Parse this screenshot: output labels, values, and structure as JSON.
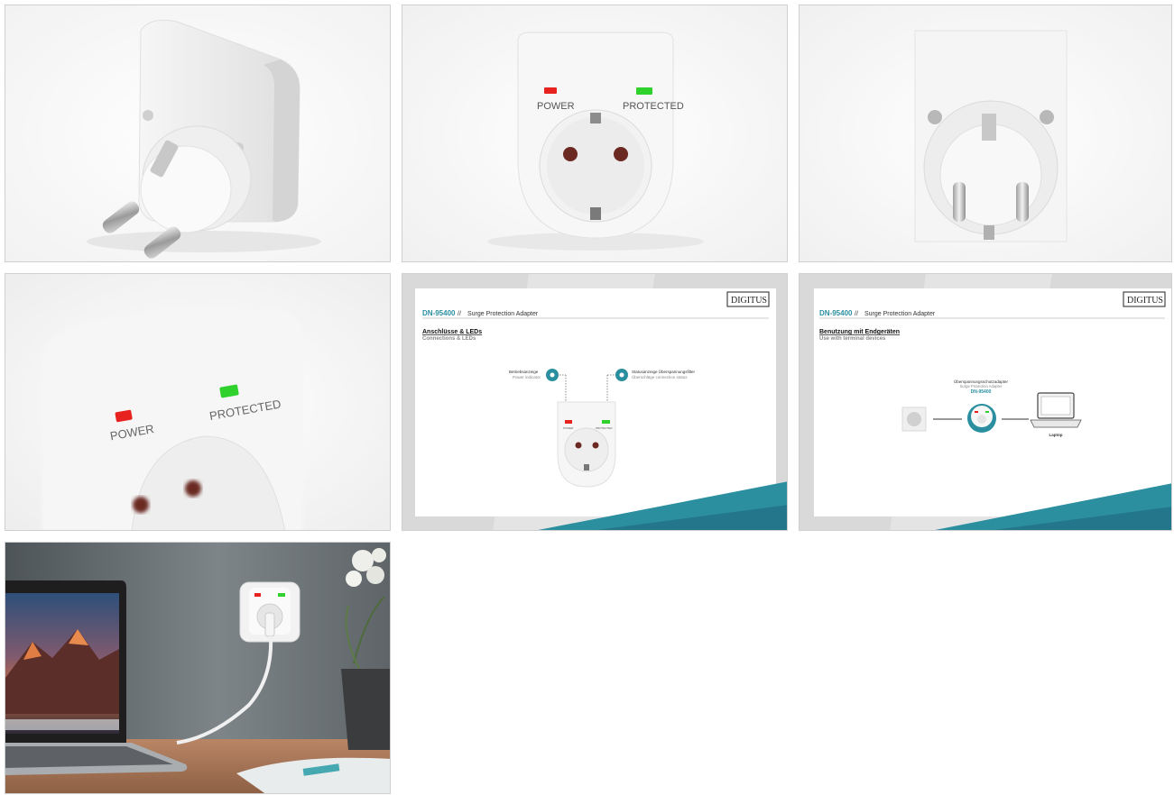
{
  "gallery": {
    "tiles": [
      {
        "subject": "adapter-side-view"
      },
      {
        "subject": "adapter-front-view"
      },
      {
        "subject": "adapter-back-view"
      },
      {
        "subject": "adapter-led-closeup"
      },
      {
        "subject": "slide-connections-leds"
      },
      {
        "subject": "slide-terminal-devices"
      },
      {
        "subject": "lifestyle-laptop-scene"
      }
    ]
  },
  "product": {
    "led_power": "POWER",
    "led_protected": "PROTECTED",
    "led_power_color": "#e8221f",
    "led_protected_color": "#2fd12c"
  },
  "slide1": {
    "model": "DN-95400",
    "separator": "//",
    "product_name": "Surge Protection Adapter",
    "brand": "DIGITUS",
    "heading_de": "Anschlüsse & LEDs",
    "heading_en": "Connections & LEDs",
    "callout_left_de": "Betriebsanzeige",
    "callout_left_en": "Power indicator",
    "callout_right_de": "Statusanzeige Überspannungsfilter",
    "callout_right_en": "Überschläge connection status",
    "mini_power": "POWER",
    "mini_protected": "PROTECTED"
  },
  "slide2": {
    "model": "DN-95400",
    "separator": "//",
    "product_name": "Surge Protection Adapter",
    "brand": "DIGITUS",
    "heading_de": "Benutzung mit Endgeräten",
    "heading_en": "Use with terminal devices",
    "caption_de": "Überspannungsschutzadapter",
    "caption_en": "Surge Protection Adapter",
    "caption_model": "DN-95400",
    "laptop_label": "Laptop"
  },
  "colors": {
    "accent_teal": "#2b8fa0",
    "slide_bg": "#d9d9d9"
  }
}
